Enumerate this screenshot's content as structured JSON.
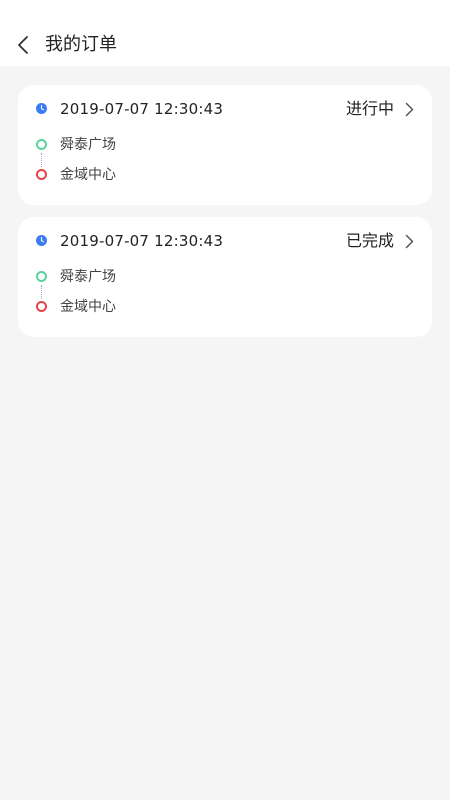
{
  "header": {
    "title": "我的订单",
    "back_icon": "chevron-left-icon"
  },
  "orders": [
    {
      "time": "2019-07-07 12:30:43",
      "status": "进行中",
      "start": "舜泰广场",
      "end": "金域中心"
    },
    {
      "time": "2019-07-07 12:30:43",
      "status": "已完成",
      "start": "舜泰广场",
      "end": "金域中心"
    }
  ],
  "colors": {
    "background": "#f5f5f5",
    "card": "#ffffff",
    "clock": "#3b7cf2",
    "start_dot": "#5ad1a0",
    "end_dot": "#e8434b",
    "route_line": "#8aa5d6"
  }
}
